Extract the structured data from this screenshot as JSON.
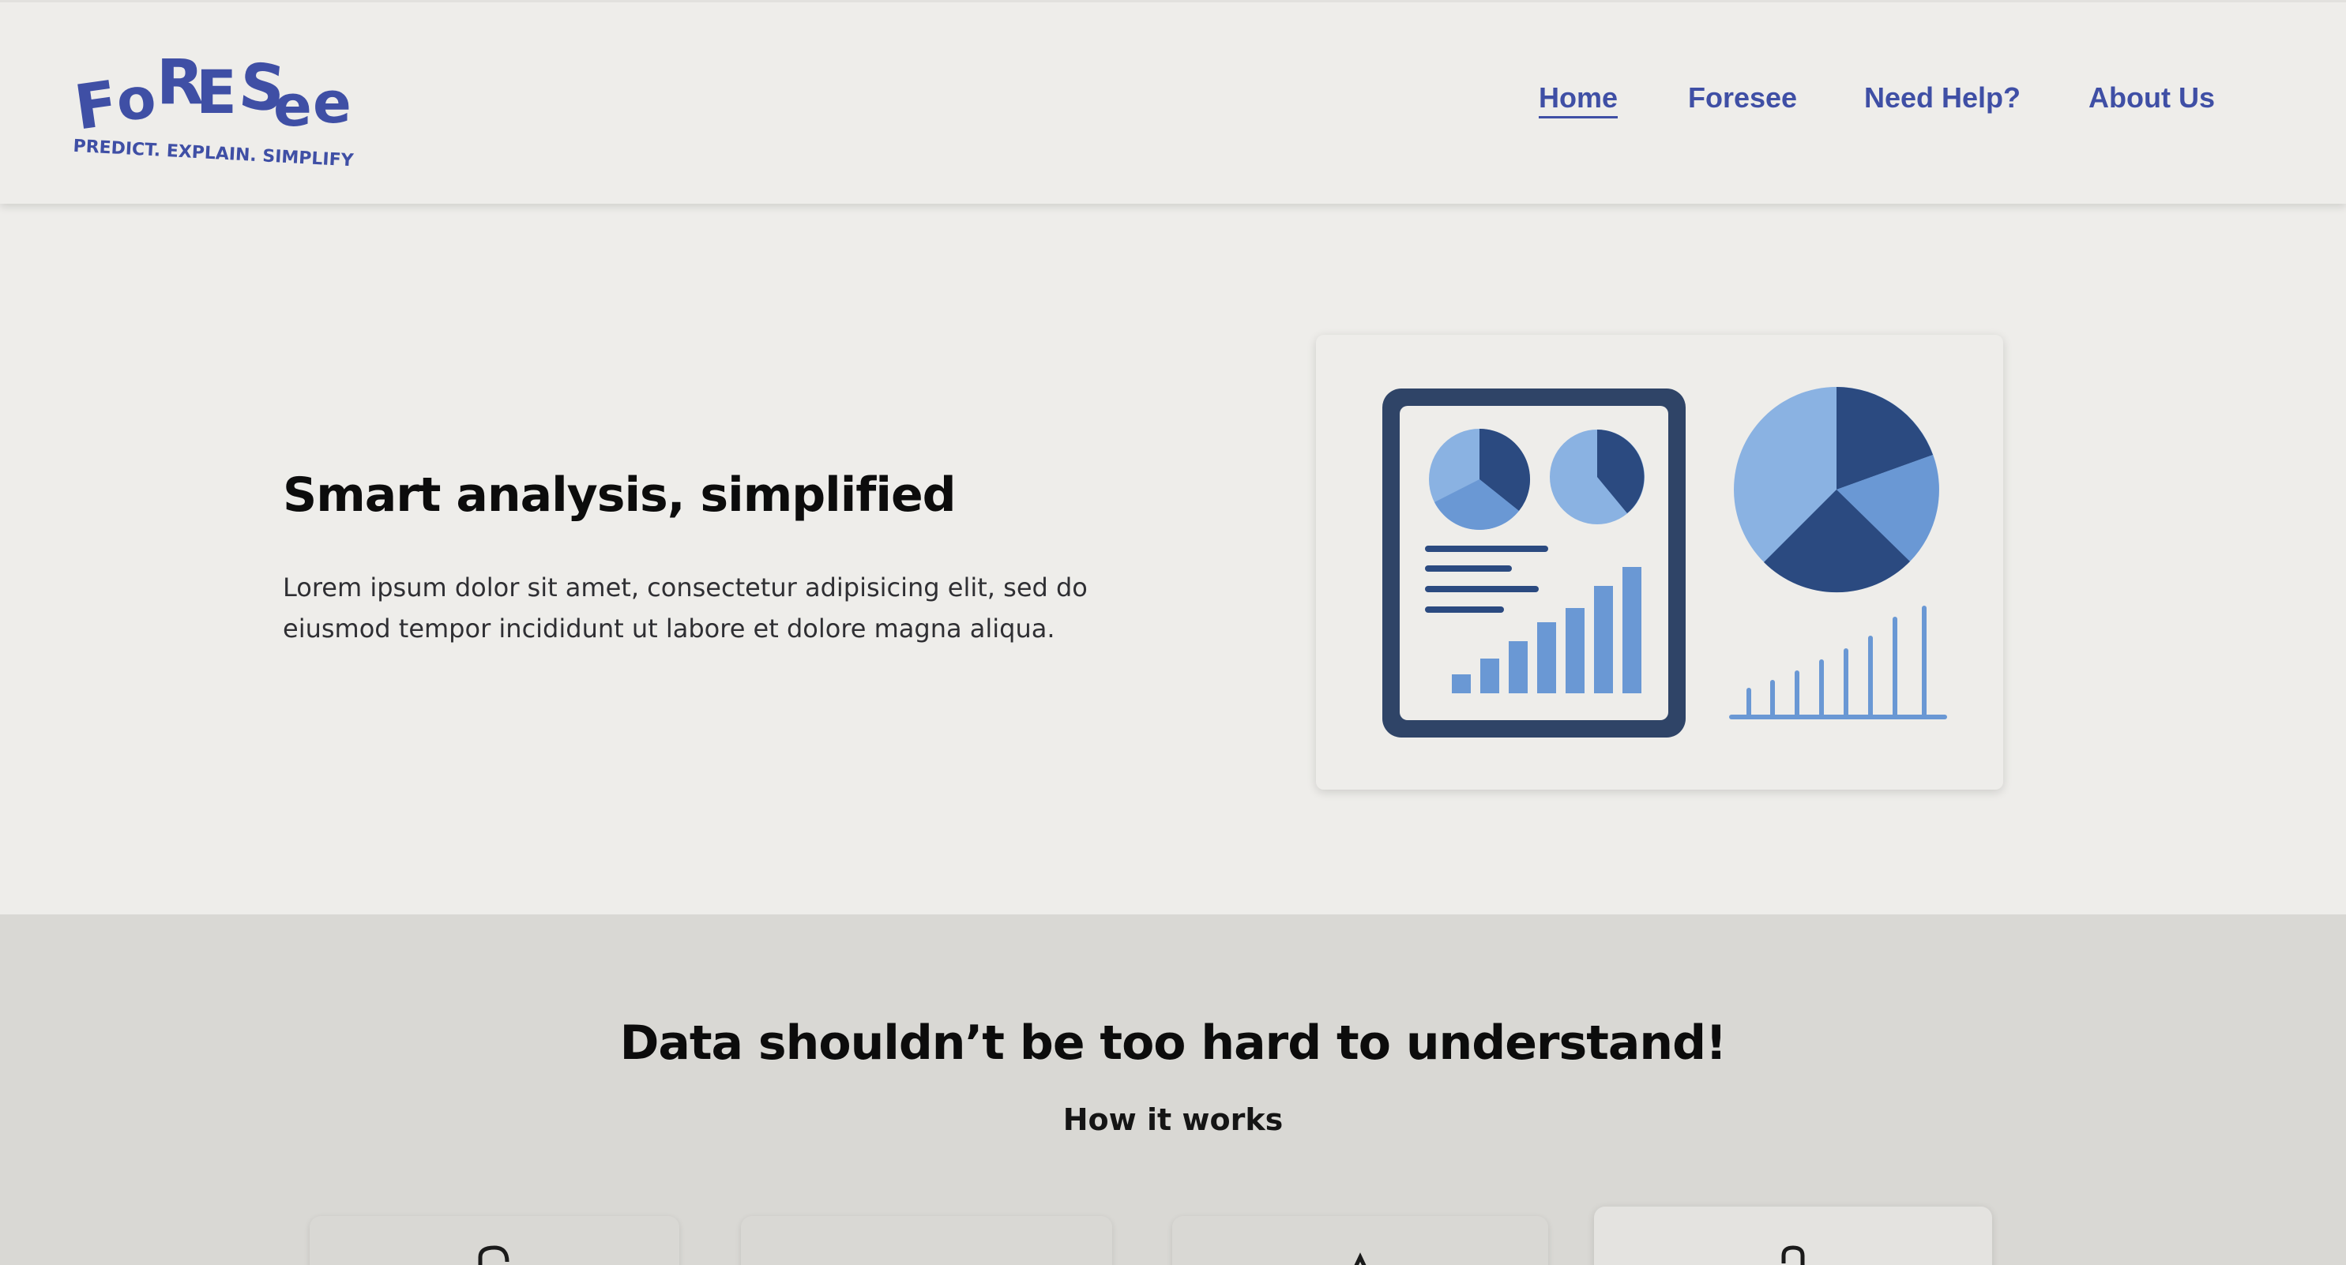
{
  "header": {
    "logo": {
      "wordmark": "FORESee",
      "tagline": "PREDICT. EXPLAIN. SIMPLIFY"
    },
    "nav": [
      {
        "label": "Home",
        "active": true
      },
      {
        "label": "Foresee",
        "active": false
      },
      {
        "label": "Need Help?",
        "active": false
      },
      {
        "label": "About Us",
        "active": false
      }
    ]
  },
  "hero": {
    "title": "Smart analysis, simplified",
    "description": "Lorem ipsum dolor sit amet, consectetur adipisicing elit, sed do eiusmod tempor incididunt ut labore et dolore magna aliqua.",
    "illustration": "dashboard-analytics-illustration"
  },
  "how_it_works": {
    "title": "Data shouldn’t be too hard to understand!",
    "subtitle": "How it works",
    "cards": [
      {
        "icon": "step-1-icon"
      },
      {
        "icon": "step-2-icon"
      },
      {
        "icon": "step-3-icon"
      },
      {
        "icon": "step-4-icon"
      }
    ]
  },
  "colors": {
    "brand": "#3f4fa5",
    "background": "#eeedea",
    "section_alt": "#d9d8d4",
    "chart_dark": "#2b4a80",
    "chart_mid": "#6a98d4",
    "chart_light": "#8ab2e2",
    "frame": "#2f4467"
  }
}
